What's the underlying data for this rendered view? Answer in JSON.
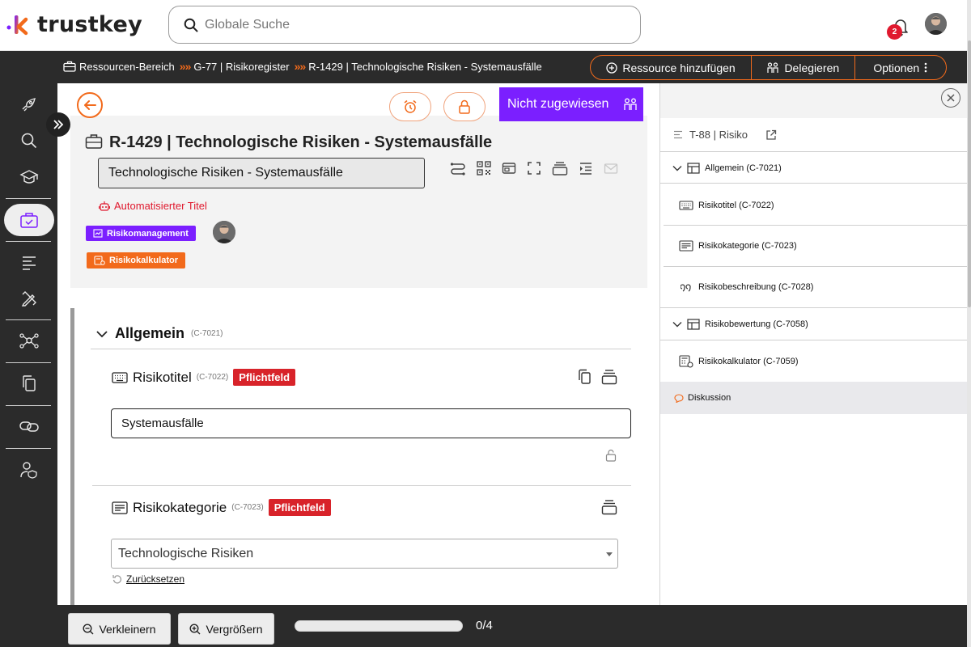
{
  "app": {
    "name": "trustkey"
  },
  "search": {
    "placeholder": "Globale Suche"
  },
  "notifications": {
    "count": "2"
  },
  "breadcrumb": {
    "items": [
      "Ressourcen-Bereich",
      "G-77 | Risikoregister",
      "R-1429 | Technologische Risiken - Systemausfälle"
    ],
    "separator": "»"
  },
  "actions": {
    "add_resource": "Ressource hinzufügen",
    "delegate": "Delegieren",
    "options": "Optionen"
  },
  "resource": {
    "title": "R-1429 | Technologische Risiken - Systemausfälle",
    "title_field_value": "Technologische Risiken - Systemausfälle",
    "auto_title": "Automatisierter Titel",
    "assign_label": "Nicht zugewiesen",
    "tags": [
      {
        "label": "Risikomanagement",
        "color": "#7b1fff"
      },
      {
        "label": "Risikokalkulator",
        "color": "#f26a1b"
      }
    ]
  },
  "section": {
    "title": "Allgemein",
    "code": "(C-7021)"
  },
  "fields": {
    "risikotitel": {
      "label": "Risikotitel",
      "code": "(C-7022)",
      "required": "Pflichtfeld",
      "value": "Systemausfälle"
    },
    "risikokategorie": {
      "label": "Risikokategorie",
      "code": "(C-7023)",
      "required": "Pflichtfeld",
      "value": "Technologische Risiken",
      "reset": "Zurücksetzen"
    }
  },
  "bottom": {
    "zoom_out": "Verkleinern",
    "zoom_in": "Vergrößern",
    "progress_text": "0/4",
    "progress_fraction": 0
  },
  "right_panel": {
    "header": "T-88 | Risiko",
    "items": [
      {
        "label": "Allgemein (C-7021)",
        "icon": "table-icon"
      },
      {
        "label": "Risikotitel (C-7022)",
        "icon": "keyboard-icon"
      },
      {
        "label": "Risikokategorie (C-7023)",
        "icon": "list-box-icon"
      },
      {
        "label": "Risikobeschreibung (C-7028)",
        "icon": "quote-icon"
      },
      {
        "label": "Risikobewertung (C-7058)",
        "icon": "table-icon"
      },
      {
        "label": "Risikokalkulator (C-7059)",
        "icon": "calculator-icon"
      }
    ],
    "discussion": "Diskussion"
  },
  "colors": {
    "accent": "#f26a1b",
    "purple": "#7b1fff",
    "required": "#d8232a",
    "dark": "#2b2b2b"
  }
}
